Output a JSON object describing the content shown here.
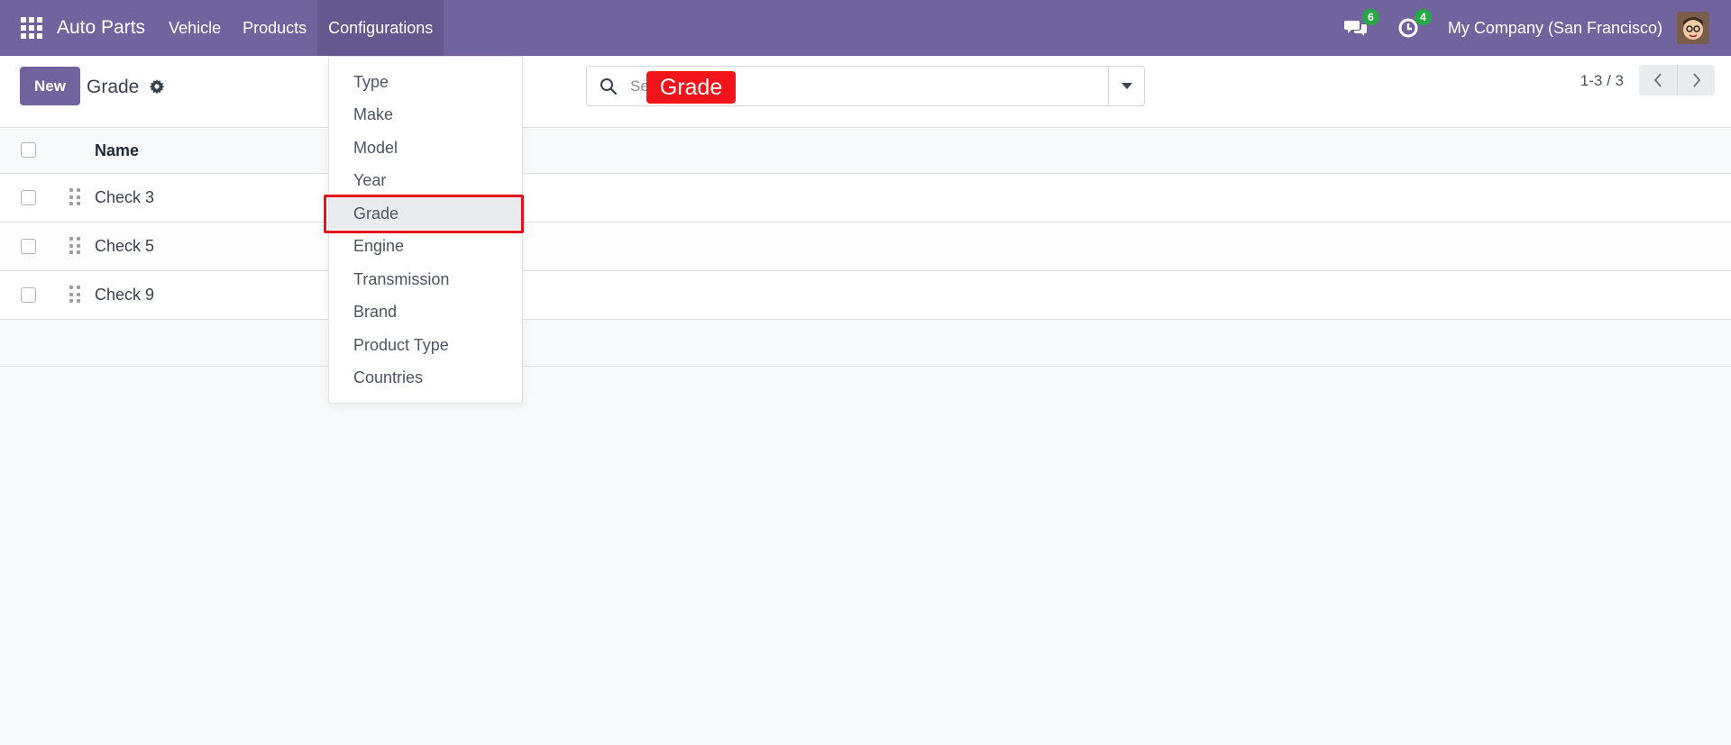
{
  "navbar": {
    "app_name": "Auto Parts",
    "menu": [
      "Vehicle",
      "Products",
      "Configurations"
    ],
    "messages_count": "6",
    "activities_count": "4",
    "company": "My Company (San Francisco)"
  },
  "control_panel": {
    "new_label": "New",
    "title": "Grade",
    "search_placeholder": "Se",
    "pager": "1-3 / 3"
  },
  "table": {
    "header_name": "Name",
    "rows": [
      "Check 3",
      "Check 5",
      "Check 9"
    ]
  },
  "dropdown": {
    "items": [
      "Type",
      "Make",
      "Model",
      "Year",
      "Grade",
      "Engine",
      "Transmission",
      "Brand",
      "Product Type",
      "Countries"
    ],
    "selected": "Grade"
  },
  "annotation": {
    "label": "Grade",
    "color": "#f2141a"
  },
  "colors": {
    "brand": "#71639e",
    "badge": "#28a745",
    "highlight": "#e3151b"
  }
}
